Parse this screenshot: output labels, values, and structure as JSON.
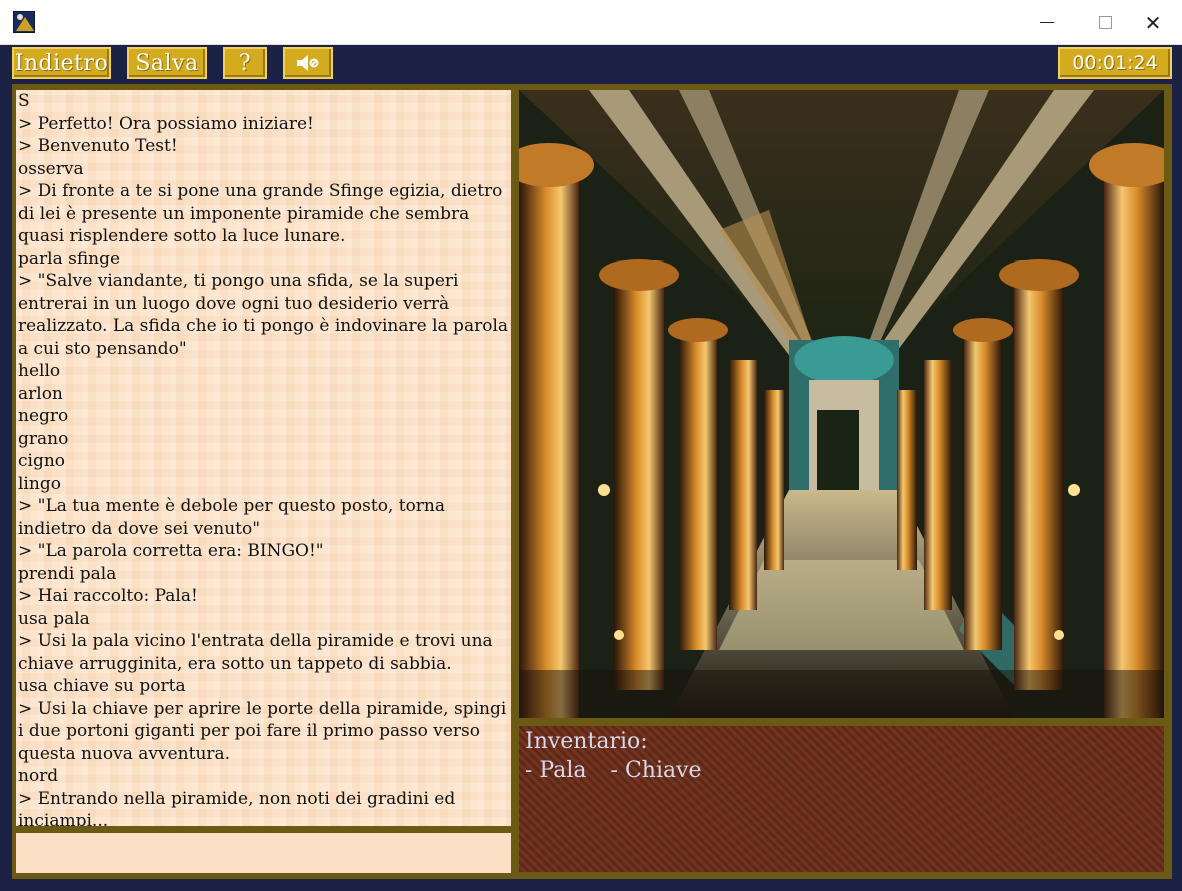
{
  "window": {
    "min_icon": "minimize-icon",
    "max_icon": "maximize-icon",
    "close_icon": "close-icon",
    "close_glyph": "✕"
  },
  "toolbar": {
    "back_label": "Indietro",
    "save_label": "Salva",
    "help_label": "?",
    "sound_icon": "speaker-muted-icon",
    "timer": "00:01:24",
    "accent_color": "#d4ab1e"
  },
  "log": {
    "lines": [
      "S",
      "> Perfetto! Ora possiamo iniziare!",
      "> Benvenuto Test!",
      "osserva",
      "> Di fronte a te si pone una grande Sfinge egizia, dietro di lei è presente un imponente piramide che sembra quasi risplendere sotto la luce lunare.",
      "parla sfinge",
      "> \"Salve viandante, ti pongo una sfida, se la superi entrerai in un luogo dove ogni tuo desiderio verrà realizzato. La sfida che io ti pongo è indovinare la parola a cui sto pensando\"",
      "hello",
      "arlon",
      "negro",
      "grano",
      "cigno",
      "lingo",
      "> \"La tua mente è debole per questo posto, torna indietro da dove sei venuto\"",
      "> \"La parola corretta era: BINGO!\"",
      "prendi pala",
      "> Hai raccolto: Pala!",
      "usa pala",
      "> Usi la pala vicino l'entrata della piramide e trovi una chiave arrugginita, era sotto un tappeto di sabbia.",
      "usa chiave su porta",
      "> Usi la chiave per aprire le porte della piramide, spingi i due portoni giganti per poi fare il primo passo verso questa nuova avventura.",
      "nord",
      "> Entrando nella piramide, non noti dei gradini ed inciampi..."
    ]
  },
  "input": {
    "value": ""
  },
  "inventory": {
    "title": "Inventario:",
    "items": [
      "- Pala",
      "- Chiave"
    ]
  }
}
